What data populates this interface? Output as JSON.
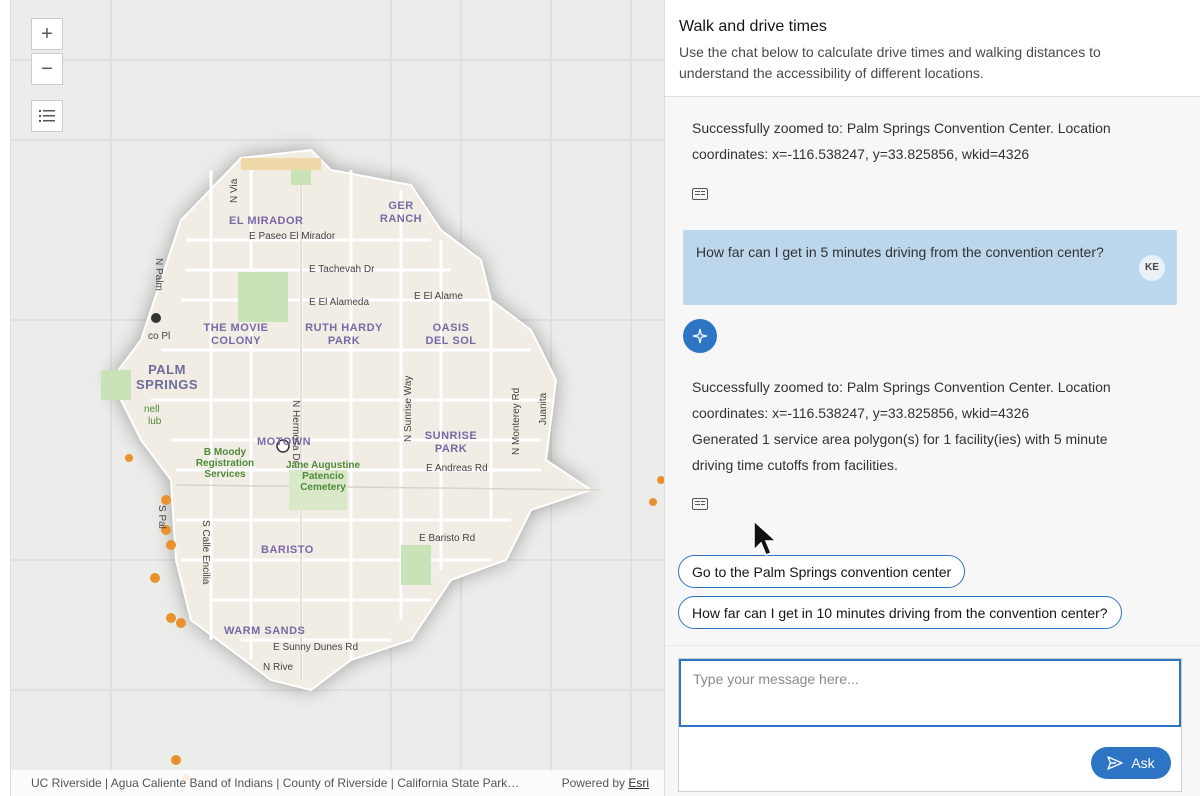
{
  "map": {
    "zoom_in_label": "+",
    "zoom_out_label": "−",
    "attribution": "UC Riverside | Agua Caliente Band of Indians | County of Riverside | California State Park…",
    "powered_by_prefix": "Powered by ",
    "powered_by_link": "Esri",
    "neighborhoods": [
      "EL MIRADOR",
      "GER RANCH",
      "THE MOVIE COLONY",
      "RUTH HARDY PARK",
      "OASIS DEL SOL",
      "PALM SPRINGS",
      "MOTOWN",
      "SUNRISE PARK",
      "BARISTO",
      "WARM SANDS"
    ],
    "streets": [
      "E Paseo El Mirador",
      "E Tachevah Dr",
      "E El Alameda",
      "E El Alame",
      "E Andreas Rd",
      "E Baristo Rd",
      "E Sunny Dunes Rd",
      "N Rive",
      "N Hermosa Dr",
      "N Sunrise Way",
      "N Monterey Rd",
      "Juanita",
      "S Calle Encilia",
      "N Via",
      "N Palm",
      "S Pal",
      "co Pl",
      "nell",
      "lub"
    ],
    "pois": [
      "B Moody Registration Services",
      "Jane Augustine Patencio Cemetery"
    ]
  },
  "panel": {
    "title": "Walk and drive times",
    "subtitle": "Use the chat below to calculate drive times and walking distances to understand the accessibility of different locations."
  },
  "chat": {
    "messages": [
      {
        "role": "assistant",
        "lines": [
          "Successfully zoomed to: Palm Springs Convention Center. Location",
          "coordinates: x=-116.538247, y=33.825856, wkid=4326"
        ]
      },
      {
        "role": "user",
        "text": "How far can I get in 5 minutes driving from the convention center?",
        "avatar": "KE"
      },
      {
        "role": "assistant",
        "lines": [
          "Successfully zoomed to: Palm Springs Convention Center. Location",
          "coordinates: x=-116.538247, y=33.825856, wkid=4326",
          "Generated 1 service area polygon(s) for 1 facility(ies) with 5 minute",
          "driving time cutoffs from facilities."
        ]
      }
    ],
    "suggestions": [
      "Go to the Palm Springs convention center",
      "How far can I get in 10 minutes driving from the convention center?"
    ]
  },
  "input": {
    "placeholder": "Type your message here...",
    "ask_label": "Ask"
  },
  "colors": {
    "accent": "#2d74c5",
    "user_bubble": "#bcd6ec",
    "map_poi": "#e8912e"
  }
}
